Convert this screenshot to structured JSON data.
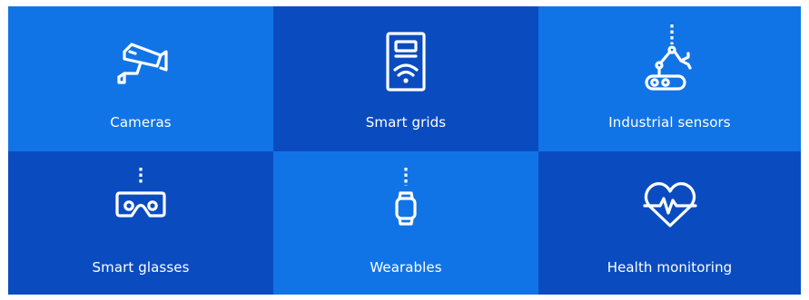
{
  "colors": {
    "light_blue": "#1174E6",
    "dark_blue": "#0A4CC0",
    "text": "#FFFFFF"
  },
  "tiles": [
    {
      "label": "Cameras",
      "icon": "camera-icon",
      "bg": "#1174E6"
    },
    {
      "label": "Smart grids",
      "icon": "smart-meter-icon",
      "bg": "#0A4CC0"
    },
    {
      "label": "Industrial sensors",
      "icon": "robotic-arm-icon",
      "bg": "#1174E6"
    },
    {
      "label": "Smart glasses",
      "icon": "vr-glasses-icon",
      "bg": "#0A4CC0"
    },
    {
      "label": "Wearables",
      "icon": "smartwatch-icon",
      "bg": "#1174E6"
    },
    {
      "label": "Health monitoring",
      "icon": "heart-pulse-icon",
      "bg": "#0A4CC0"
    }
  ]
}
